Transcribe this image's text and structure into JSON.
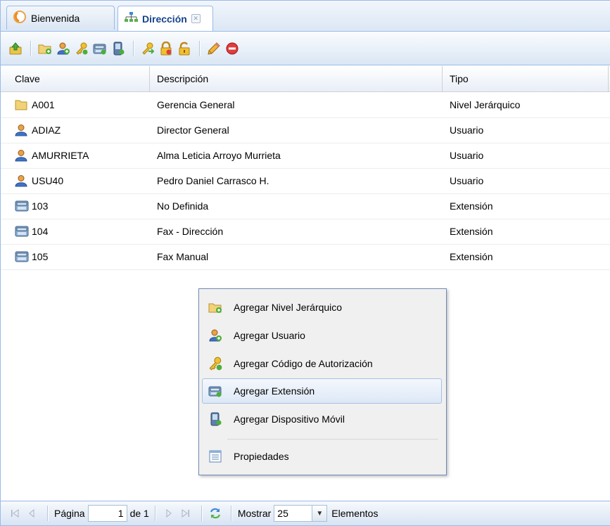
{
  "tabs": [
    {
      "label": "Bienvenida",
      "icon": "welcome-icon",
      "active": false
    },
    {
      "label": "Dirección",
      "icon": "org-chart-icon",
      "active": true,
      "closable": true
    }
  ],
  "toolbar": {
    "buttons": [
      "up-level-icon",
      "add-folder-icon",
      "add-user-icon",
      "add-key-icon",
      "add-phone-icon",
      "add-mobile-icon",
      "move-key-icon",
      "lock-icon",
      "unlock-icon",
      "edit-pencil-icon",
      "delete-icon"
    ]
  },
  "grid": {
    "columns": [
      "Clave",
      "Descripción",
      "Tipo"
    ],
    "rows": [
      {
        "icon": "folder-icon",
        "clave": "A001",
        "descripcion": "Gerencia General",
        "tipo": "Nivel Jerárquico"
      },
      {
        "icon": "user-icon",
        "clave": "ADIAZ",
        "descripcion": "Director General",
        "tipo": "Usuario"
      },
      {
        "icon": "user-icon",
        "clave": "AMURRIETA",
        "descripcion": "Alma Leticia Arroyo Murrieta",
        "tipo": "Usuario"
      },
      {
        "icon": "user-icon",
        "clave": "USU40",
        "descripcion": "Pedro Daniel Carrasco H.",
        "tipo": "Usuario"
      },
      {
        "icon": "phone-icon",
        "clave": "103",
        "descripcion": "No Definida",
        "tipo": "Extensión"
      },
      {
        "icon": "phone-icon",
        "clave": "104",
        "descripcion": "Fax - Dirección",
        "tipo": "Extensión"
      },
      {
        "icon": "phone-icon",
        "clave": "105",
        "descripcion": "Fax Manual",
        "tipo": "Extensión"
      }
    ]
  },
  "context_menu": {
    "items": [
      {
        "label": "Agregar Nivel Jerárquico",
        "icon": "add-folder-icon"
      },
      {
        "label": "Agregar Usuario",
        "icon": "add-user-icon"
      },
      {
        "label": "Agregar Código de Autorización",
        "icon": "add-key-icon"
      },
      {
        "label": "Agregar Extensión",
        "icon": "add-phone-icon",
        "highlighted": true
      },
      {
        "label": "Agregar Dispositivo Móvil",
        "icon": "add-mobile-icon"
      },
      {
        "label": "Propiedades",
        "icon": "properties-icon"
      }
    ]
  },
  "paging": {
    "page_label": "Página",
    "page_value": "1",
    "of_label": "de 1",
    "show_label": "Mostrar",
    "page_size": "25",
    "elements_label": "Elementos"
  }
}
